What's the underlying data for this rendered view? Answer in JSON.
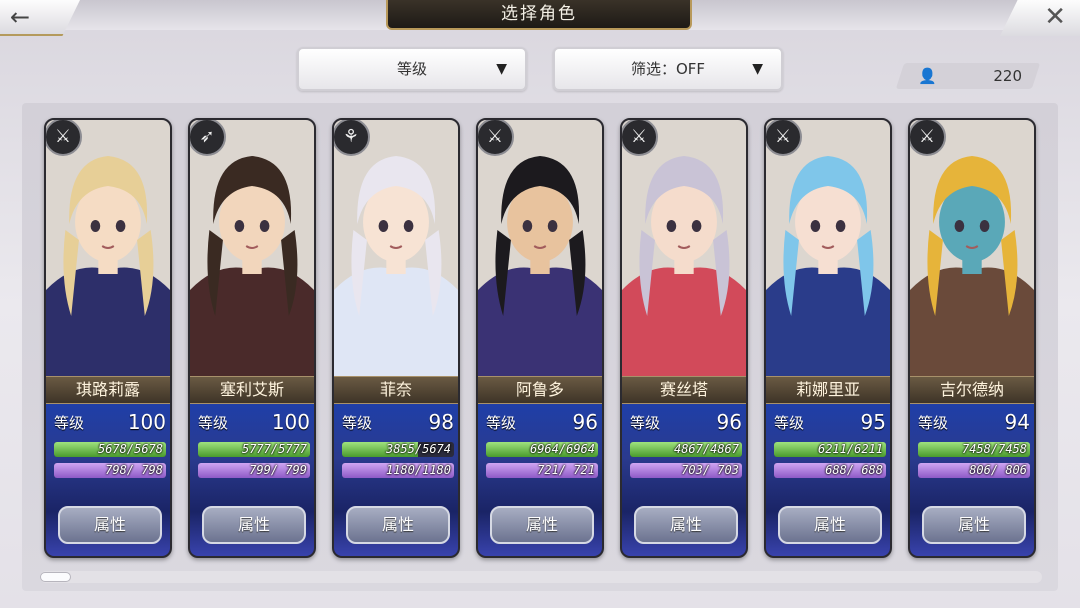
{
  "header": {
    "title": "选择角色",
    "back_icon": "arrow-left-icon",
    "close_icon": "close-icon"
  },
  "filters": {
    "sort_label": "等级",
    "filter_label": "筛选：OFF",
    "character_count": "220"
  },
  "cards": [
    {
      "name": "琪路莉露",
      "level_label": "等级",
      "level": "100",
      "hp": "5678/5678",
      "hp_fraction": 1.0,
      "mp": "798/ 798",
      "mp_fraction": 1.0,
      "button": "属性",
      "weapon": "sword-icon",
      "hair": "#e7cf97",
      "skin": "#f5dcc4",
      "outfit": "#2d2f6a"
    },
    {
      "name": "塞利艾斯",
      "level_label": "等级",
      "level": "100",
      "hp": "5777/5777",
      "hp_fraction": 1.0,
      "mp": "799/ 799",
      "mp_fraction": 1.0,
      "button": "属性",
      "weapon": "bow-icon",
      "hair": "#3a2a22",
      "skin": "#f2d6bc",
      "outfit": "#4a2a2a"
    },
    {
      "name": "菲奈",
      "level_label": "等级",
      "level": "98",
      "hp": "3855/5674",
      "hp_fraction": 0.68,
      "mp": "1180/1180",
      "mp_fraction": 1.0,
      "button": "属性",
      "weapon": "staff-icon",
      "hair": "#e9e6ef",
      "skin": "#f7e3d4",
      "outfit": "#dfe6f5"
    },
    {
      "name": "阿鲁多",
      "level_label": "等级",
      "level": "96",
      "hp": "6964/6964",
      "hp_fraction": 1.0,
      "mp": "721/ 721",
      "mp_fraction": 1.0,
      "button": "属性",
      "weapon": "sword-icon",
      "hair": "#1c1a1e",
      "skin": "#e8c39e",
      "outfit": "#3a3274"
    },
    {
      "name": "赛丝塔",
      "level_label": "等级",
      "level": "96",
      "hp": "4867/4867",
      "hp_fraction": 1.0,
      "mp": "703/ 703",
      "mp_fraction": 1.0,
      "button": "属性",
      "weapon": "sword-icon",
      "hair": "#c9c3d6",
      "skin": "#f5dccc",
      "outfit": "#d24a5a"
    },
    {
      "name": "莉娜里亚",
      "level_label": "等级",
      "level": "95",
      "hp": "6211/6211",
      "hp_fraction": 1.0,
      "mp": "688/ 688",
      "mp_fraction": 1.0,
      "button": "属性",
      "weapon": "sword-icon",
      "hair": "#7fc6ea",
      "skin": "#f6dfd2",
      "outfit": "#2a3c8a"
    },
    {
      "name": "吉尔德纳",
      "level_label": "等级",
      "level": "94",
      "hp": "7458/7458",
      "hp_fraction": 1.0,
      "mp": "806/ 806",
      "mp_fraction": 1.0,
      "button": "属性",
      "weapon": "sword-icon",
      "hair": "#e6b43a",
      "skin": "#5aa8b8",
      "outfit": "#6a4a3a"
    }
  ],
  "scrollbar": {
    "position": 0.0
  }
}
